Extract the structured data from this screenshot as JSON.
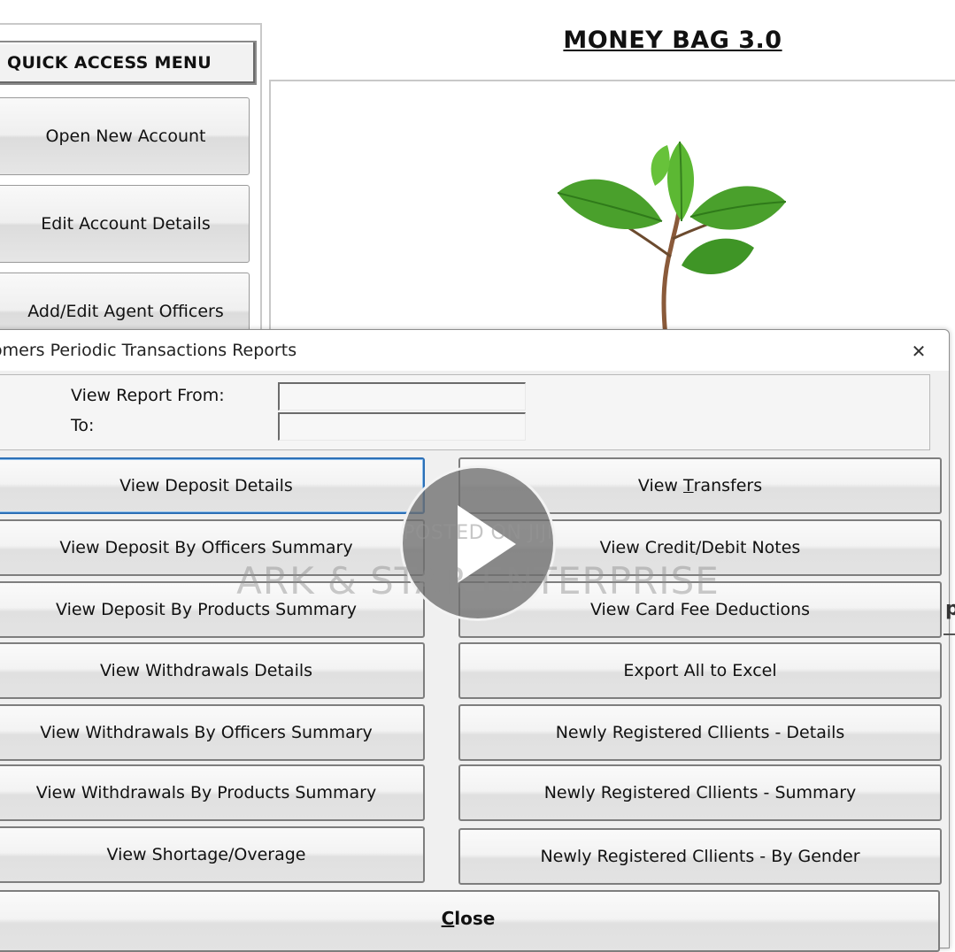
{
  "app": {
    "title": "MONEY BAG 3.0"
  },
  "quick_access": {
    "header": "QUICK ACCESS MENU",
    "items": [
      {
        "label": "Open New Account"
      },
      {
        "label": "Edit Account Details"
      },
      {
        "label": "Add/Edit Agent Officers"
      }
    ]
  },
  "dialog": {
    "title": "omers Periodic Transactions Reports",
    "close_glyph": "✕",
    "date_range": {
      "from_label": "View Report From:",
      "to_label": "To:",
      "from_value": "",
      "to_value": ""
    },
    "left_buttons": [
      {
        "label": "View Deposit Details"
      },
      {
        "label": "View Deposit By Officers Summary"
      },
      {
        "label": "View Deposit By Products Summary"
      },
      {
        "label": "View Withdrawals Details"
      },
      {
        "label": "View Withdrawals By Officers Summary"
      },
      {
        "label": "View Withdrawals By Products Summary"
      },
      {
        "label": "View Shortage/Overage"
      }
    ],
    "right_buttons": [
      {
        "label_pre": "View ",
        "label_ul": "T",
        "label_post": "ransfers"
      },
      {
        "label": "View Credit/Debit Notes"
      },
      {
        "label": "View Card Fee Deductions"
      },
      {
        "label": "Export All to Excel"
      },
      {
        "label": "Newly Registered Cllients - Details"
      },
      {
        "label": "Newly Registered Cllients - Summary"
      },
      {
        "label": "Newly Registered Cllients - By Gender"
      }
    ],
    "close_button": {
      "ul": "C",
      "rest": "lose"
    }
  },
  "overlay": {
    "posted_text": "POSTED ON JIJI",
    "watermark": "ARK & STAR ENTERPRISE"
  },
  "edge_glyph": "p",
  "colors": {
    "focus_border": "#2b6fb6",
    "dialog_bg": "#f0f0f0",
    "leaf_green": "#4aa02c"
  }
}
